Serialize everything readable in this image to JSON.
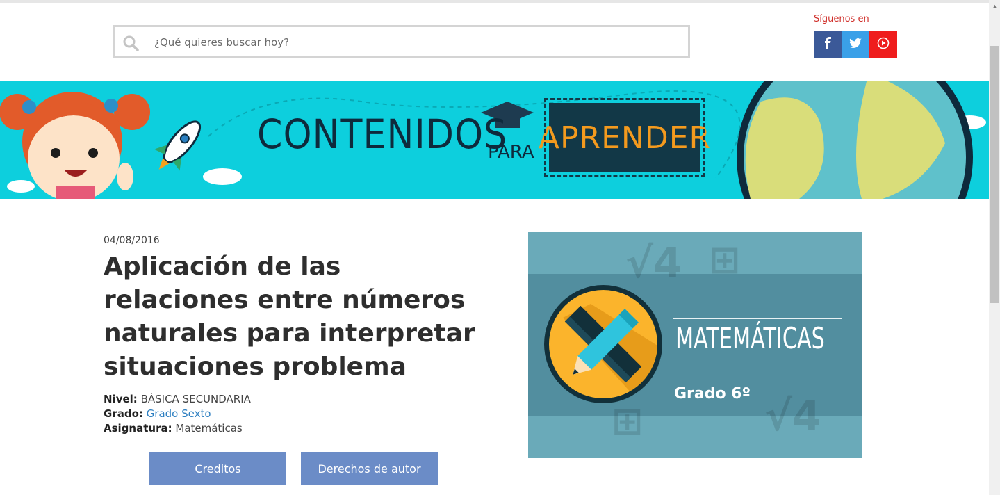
{
  "search": {
    "placeholder": "¿Qué quieres buscar hoy?"
  },
  "social": {
    "follow_label": "Síguenos en",
    "items": [
      {
        "name": "facebook",
        "icon": "facebook-icon",
        "color": "#3b5998"
      },
      {
        "name": "twitter",
        "icon": "twitter-icon",
        "color": "#3aa0e8"
      },
      {
        "name": "youtube",
        "icon": "youtube-icon",
        "color": "#ef1d1d"
      }
    ]
  },
  "banner": {
    "title": "CONTENIDOS",
    "connector": "PARA",
    "highlight": "APRENDER",
    "background": "#0dcfdd",
    "accent": "#f39a1e"
  },
  "article": {
    "date": "04/08/2016",
    "title": "Aplicación de las relaciones entre números naturales para interpretar situaciones problema",
    "level_label": "Nivel:",
    "level_value": "BÁSICA SECUNDARIA",
    "grade_label": "Grado:",
    "grade_value": "Grado Sexto",
    "subject_label": "Asignatura:",
    "subject_value": "Matemáticas"
  },
  "buttons": {
    "credits": "Creditos",
    "rights": "Derechos de autor",
    "color": "#6b8cc7"
  },
  "course_image": {
    "subject": "MATEMÁTICAS",
    "grade": "Grado 6º",
    "icon": "pencil-ruler-icon"
  }
}
